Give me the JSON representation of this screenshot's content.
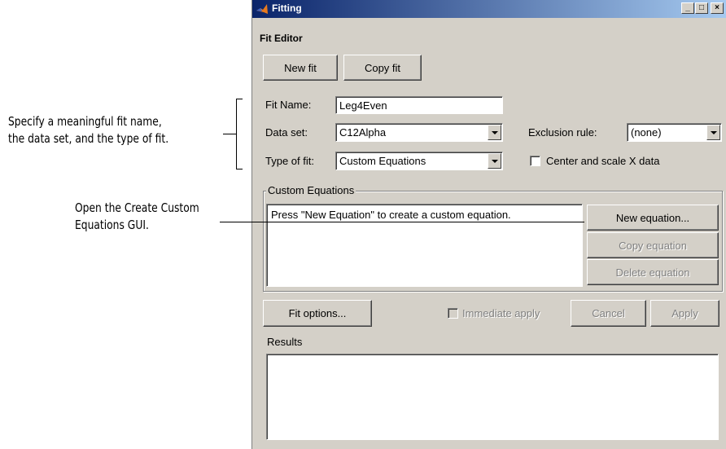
{
  "annotations": {
    "fit_spec": [
      "Specify a meaningful fit name,",
      "the data set, and the type of fit."
    ],
    "custom_gui": [
      "Open the Create Custom",
      "Equations GUI."
    ]
  },
  "window": {
    "title": "Fitting",
    "controls": {
      "minimize": "_",
      "maximize": "□",
      "close": "×"
    }
  },
  "fit_editor": {
    "heading": "Fit Editor",
    "new_fit_label": "New fit",
    "copy_fit_label": "Copy fit",
    "fit_name_label": "Fit Name:",
    "fit_name_value": "Leg4Even",
    "data_set_label": "Data set:",
    "data_set_value": "C12Alpha",
    "exclusion_label": "Exclusion rule:",
    "exclusion_value": "(none)",
    "type_label": "Type of fit:",
    "type_value": "Custom Equations",
    "center_scale_label": "Center and scale X data",
    "center_scale_checked": false
  },
  "custom_equations": {
    "group_title": "Custom Equations",
    "list_item": "Press \"New Equation\" to create a custom equation.",
    "new_label": "New equation...",
    "copy_label": "Copy equation",
    "delete_label": "Delete equation"
  },
  "bottom": {
    "fit_options_label": "Fit options...",
    "immediate_apply_label": "Immediate apply",
    "immediate_apply_checked": false,
    "cancel_label": "Cancel",
    "apply_label": "Apply",
    "results_label": "Results",
    "results_text": ""
  },
  "colors": {
    "titlebar_start": "#0a246a",
    "titlebar_end": "#a6caf0",
    "window_bg": "#d4d0c8"
  }
}
